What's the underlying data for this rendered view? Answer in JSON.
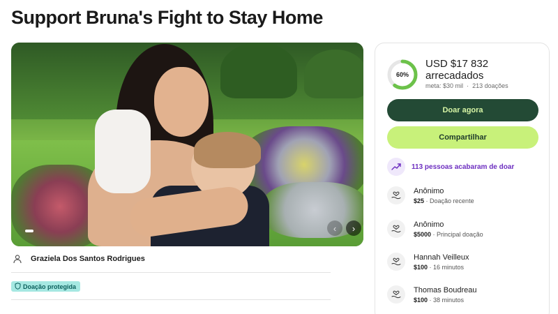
{
  "campaign": {
    "title": "Support Bruna's Fight to Stay Home",
    "organizer": "Graziela Dos Santos Rodrigues",
    "protected_label": "Doação protegida"
  },
  "gallery": {
    "prev_glyph": "‹",
    "next_glyph": "›"
  },
  "progress": {
    "percent_label": "60%",
    "fraction": 0.6,
    "raised_text": "USD $17 832 arrecadados",
    "goal": "meta: $30 mil",
    "separator": "·",
    "donation_count": "213 doações"
  },
  "actions": {
    "donate_label": "Doar agora",
    "share_label": "Compartilhar"
  },
  "recent_activity": {
    "text": "113 pessoas acabaram de doar"
  },
  "donations": [
    {
      "name": "Anônimo",
      "amount": "$25",
      "detail": "Doação recente"
    },
    {
      "name": "Anônimo",
      "amount": "$5000",
      "detail": "Principal doação"
    },
    {
      "name": "Hannah Veilleux",
      "amount": "$100",
      "detail": "16 minutos"
    },
    {
      "name": "Thomas Boudreau",
      "amount": "$100",
      "detail": "38 minutos"
    }
  ],
  "colors": {
    "donate_bg": "#234a35",
    "share_bg": "#c8f17a",
    "progress_ring": "#6cc24a",
    "activity_text": "#6d2fc0",
    "protected_bg": "#a6e8e2"
  },
  "icons": {
    "organizer": "person-icon",
    "protected": "shield-icon",
    "activity": "trending-up-icon",
    "donation": "heart-hand-icon",
    "prev": "chevron-left-icon",
    "next": "chevron-right-icon"
  }
}
